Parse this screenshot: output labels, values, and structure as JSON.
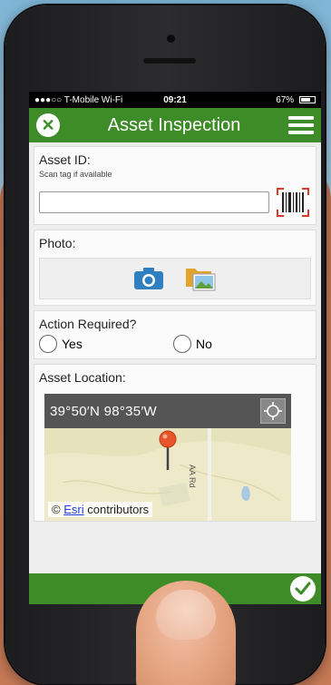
{
  "status": {
    "carrier": "●●●○○ T-Mobile Wi-Fi",
    "time": "09:21",
    "battery": "67%"
  },
  "app": {
    "title": "Asset Inspection",
    "accent_color": "#3d8c28"
  },
  "form": {
    "asset_id": {
      "label": "Asset ID:",
      "hint": "Scan tag if available",
      "value": "",
      "barcode_icon": "barcode-scan-icon"
    },
    "photo": {
      "label": "Photo:",
      "camera_icon": "camera-icon",
      "gallery_icon": "folder-image-icon"
    },
    "action_required": {
      "label": "Action Required?",
      "options": [
        "Yes",
        "No"
      ],
      "selected": null
    },
    "location": {
      "label": "Asset Location:",
      "coordinates": "39°50′N 98°35′W",
      "road_label": "AA Rd",
      "attribution_prefix": "©",
      "attribution_link": "Esri",
      "attribution_suffix": "contributors"
    }
  },
  "footer": {
    "submit_icon": "checkmark-icon"
  }
}
